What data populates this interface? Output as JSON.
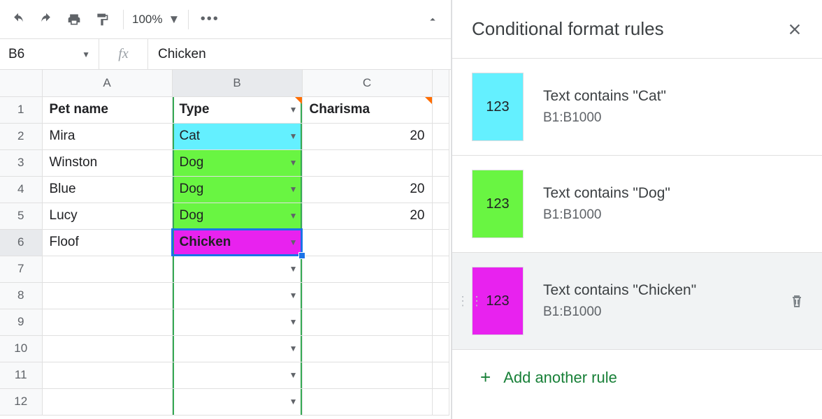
{
  "toolbar": {
    "zoom": "100%"
  },
  "namebox": {
    "ref": "B6"
  },
  "formula": {
    "value": "Chicken"
  },
  "columns": [
    "A",
    "B",
    "C"
  ],
  "headers": {
    "a": "Pet name",
    "b": "Type",
    "c": "Charisma"
  },
  "rows": [
    {
      "n": "1"
    },
    {
      "n": "2",
      "a": "Mira",
      "b": "Cat",
      "c": "20",
      "bcolor": "#64f0ff"
    },
    {
      "n": "3",
      "a": "Winston",
      "b": "Dog",
      "c": "",
      "bcolor": "#69f542"
    },
    {
      "n": "4",
      "a": "Blue",
      "b": "Dog",
      "c": "20",
      "bcolor": "#69f542"
    },
    {
      "n": "5",
      "a": "Lucy",
      "b": "Dog",
      "c": "20",
      "bcolor": "#69f542"
    },
    {
      "n": "6",
      "a": "Floof",
      "b": "Chicken",
      "c": "",
      "bcolor": "#e822ef"
    },
    {
      "n": "7"
    },
    {
      "n": "8"
    },
    {
      "n": "9"
    },
    {
      "n": "10"
    },
    {
      "n": "11"
    },
    {
      "n": "12"
    }
  ],
  "sidebar": {
    "title": "Conditional format rules",
    "rules": [
      {
        "label": "Text contains \"Cat\"",
        "range": "B1:B1000",
        "color": "#64f0ff",
        "sample": "123"
      },
      {
        "label": "Text contains \"Dog\"",
        "range": "B1:B1000",
        "color": "#69f542",
        "sample": "123"
      },
      {
        "label": "Text contains \"Chicken\"",
        "range": "B1:B1000",
        "color": "#e822ef",
        "sample": "123"
      }
    ],
    "add": "Add another rule"
  }
}
